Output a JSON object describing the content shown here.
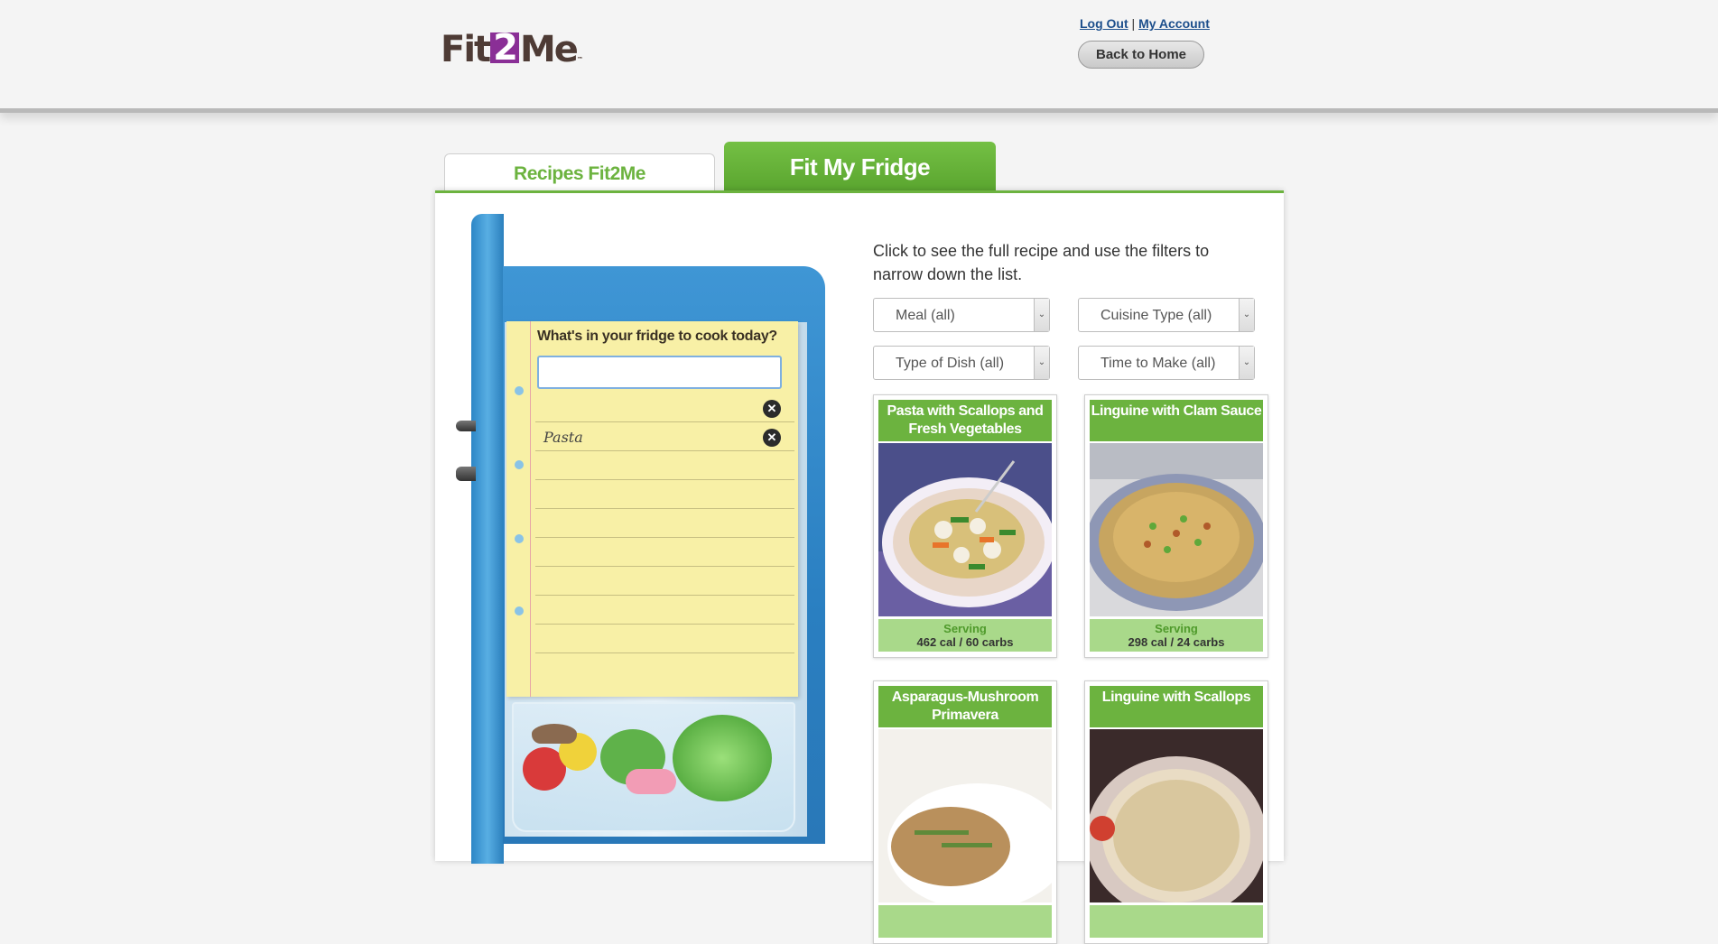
{
  "header": {
    "logo": {
      "part1": "Fit",
      "part2": "2",
      "part3": "Me",
      "tm": "™"
    },
    "logout_label": "Log Out",
    "separator": "|",
    "account_label": "My Account",
    "back_label": "Back to Home"
  },
  "tabs": [
    {
      "label": "Recipes Fit2Me",
      "active": false
    },
    {
      "label": "Fit My Fridge",
      "active": true
    }
  ],
  "fridge": {
    "title": "What's in your fridge to cook today?",
    "input_value": "",
    "items": [
      "",
      "Pasta"
    ]
  },
  "intro_text": "Click to see the full recipe and use the filters to narrow down the list.",
  "filters": [
    {
      "label": "Meal (all)"
    },
    {
      "label": "Cuisine Type (all)"
    },
    {
      "label": "Type of Dish (all)"
    },
    {
      "label": "Time to Make (all)"
    }
  ],
  "recipes": [
    {
      "title": "Pasta with Scallops and Fresh Vegetables",
      "serving_label": "Serving",
      "nutrition": "462 cal / 60 carbs"
    },
    {
      "title": "Linguine with Clam Sauce",
      "serving_label": "Serving",
      "nutrition": "298 cal / 24 carbs"
    },
    {
      "title": "Asparagus-Mushroom Primavera",
      "serving_label": "",
      "nutrition": ""
    },
    {
      "title": "Linguine with Scallops",
      "serving_label": "",
      "nutrition": ""
    }
  ],
  "colors": {
    "brand_green": "#6cb33f",
    "brand_purple": "#8a2f96",
    "link_blue": "#1d4f8c",
    "fridge_blue": "#2a7fc1"
  }
}
